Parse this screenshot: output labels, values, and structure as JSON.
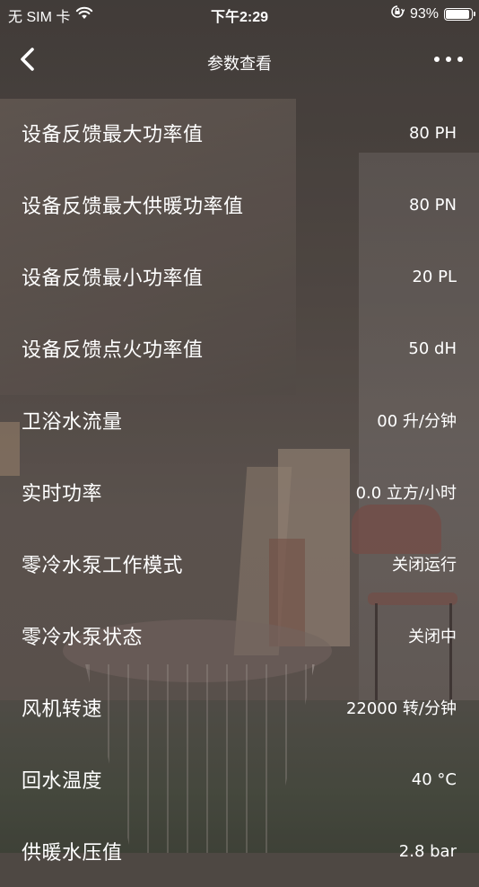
{
  "status_bar": {
    "carrier": "无 SIM 卡",
    "wifi_icon": "wifi-icon",
    "time": "下午2:29",
    "orientation_lock_icon": "orientation-lock-icon",
    "battery_percent": "93%",
    "battery_level": 0.93
  },
  "nav": {
    "back_icon": "chevron-left-icon",
    "title": "参数查看",
    "more_icon": "more-dots-icon"
  },
  "params": [
    {
      "label": "设备反馈最大功率值",
      "value": "80 PH"
    },
    {
      "label": "设备反馈最大供暖功率值",
      "value": "80 PN"
    },
    {
      "label": "设备反馈最小功率值",
      "value": "20 PL"
    },
    {
      "label": "设备反馈点火功率值",
      "value": "50 dH"
    },
    {
      "label": "卫浴水流量",
      "value": "00 升/分钟"
    },
    {
      "label": "实时功率",
      "value": "0.0 立方/小时"
    },
    {
      "label": "零冷水泵工作模式",
      "value": "关闭运行"
    },
    {
      "label": "零冷水泵状态",
      "value": "关闭中"
    },
    {
      "label": "风机转速",
      "value": "22000 转/分钟"
    },
    {
      "label": "回水温度",
      "value": "40 °C"
    },
    {
      "label": "供暖水压值",
      "value": "2.8 bar"
    }
  ]
}
